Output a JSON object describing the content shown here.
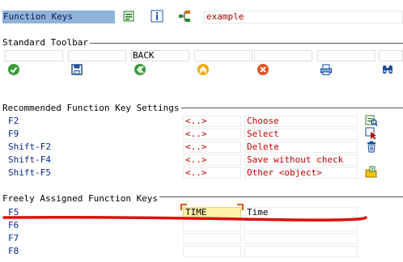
{
  "header": {
    "title": "Function Keys",
    "example": "example",
    "icons": [
      "document-icon",
      "info-icon",
      "hierarchy-icon"
    ]
  },
  "standard_toolbar": {
    "title": "Standard Toolbar",
    "cells": [
      "",
      "",
      "BACK",
      "",
      "",
      "",
      ""
    ],
    "icons": [
      "check-icon",
      "save-icon",
      "back-icon",
      "exit-icon",
      "cancel-icon",
      "print-icon",
      "find-icon"
    ]
  },
  "recommended": {
    "title": "Recommended Function Key Settings",
    "rows": [
      {
        "key": "F2",
        "code": "<..>",
        "text": "Choose",
        "icon": "choose-icon"
      },
      {
        "key": "F9",
        "code": "<..>",
        "text": "Select",
        "icon": "select-icon"
      },
      {
        "key": "Shift-F2",
        "code": "<..>",
        "text": "Delete",
        "icon": "trash-icon"
      },
      {
        "key": "Shift-F4",
        "code": "<..>",
        "text": "Save without check",
        "icon": ""
      },
      {
        "key": "Shift-F5",
        "code": "<..>",
        "text": "Other <object>",
        "icon": "other-object-icon"
      }
    ]
  },
  "freely_assigned": {
    "title": "Freely Assigned Function Keys",
    "rows": [
      {
        "key": "F5",
        "code": "TIME",
        "text": "Time"
      },
      {
        "key": "F6",
        "code": "",
        "text": ""
      },
      {
        "key": "F7",
        "code": "",
        "text": ""
      },
      {
        "key": "F8",
        "code": "",
        "text": ""
      }
    ]
  },
  "colors": {
    "title_bg": "#8fb3d9",
    "key_label": "#0a2a8a",
    "code_text": "#c00000",
    "highlight": "#fff2a8",
    "annotation_line": "#dd1111"
  }
}
